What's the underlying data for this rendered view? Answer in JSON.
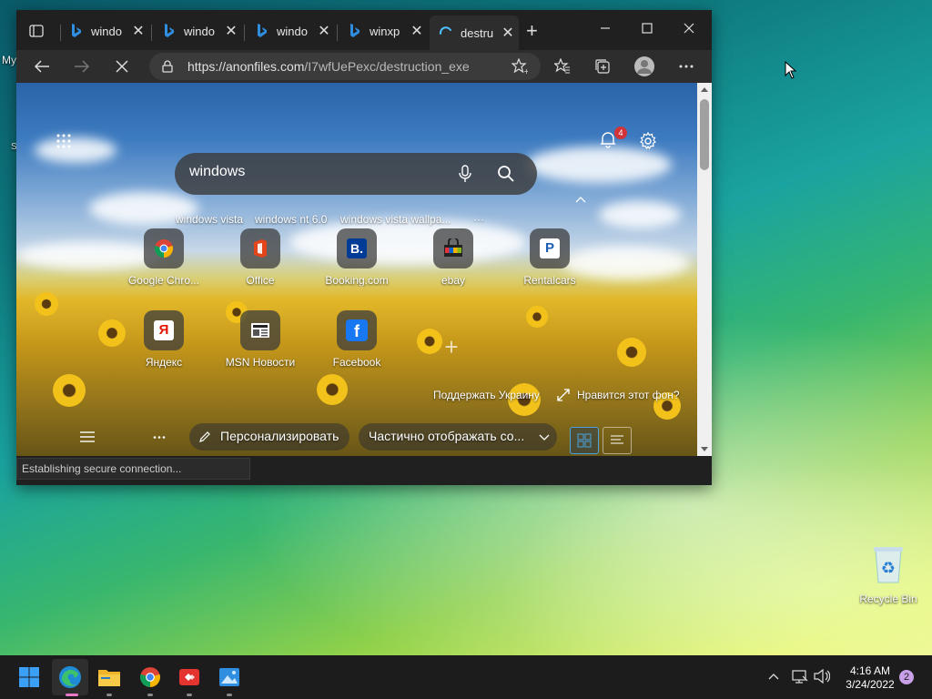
{
  "desktop": {
    "left_fragment_1": "My",
    "left_fragment_2": "S",
    "recycle_bin_label": "Recycle Bin"
  },
  "browser": {
    "tabs": [
      {
        "title": "windo",
        "icon": "bing-icon"
      },
      {
        "title": "windo",
        "icon": "bing-icon"
      },
      {
        "title": "windo",
        "icon": "bing-icon"
      },
      {
        "title": "winxp",
        "icon": "bing-icon"
      },
      {
        "title": "destru",
        "icon": "loading-icon",
        "active": true
      }
    ],
    "address": {
      "host": "https://anonfiles.com",
      "path": "/I7wfUePexc/destruction_exe"
    },
    "status": "Establishing secure connection..."
  },
  "newtab": {
    "notification_count": "4",
    "search_query": "windows",
    "suggestions": [
      "windows vista",
      "windows nt 6.0",
      "windows vista wallpa...",
      "···"
    ],
    "tiles": [
      {
        "label": "Google Chro...",
        "icon": "chrome-icon"
      },
      {
        "label": "Office",
        "icon": "office-icon"
      },
      {
        "label": "Booking.com",
        "icon": "booking-icon"
      },
      {
        "label": "ebay",
        "icon": "ebay-icon"
      },
      {
        "label": "Rentalcars",
        "icon": "rentalcars-icon"
      },
      {
        "label": "Яндекс",
        "icon": "yandex-icon"
      },
      {
        "label": "MSN Новости",
        "icon": "msn-news-icon"
      },
      {
        "label": "Facebook",
        "icon": "facebook-icon"
      }
    ],
    "support_ukraine": "Поддержать Украину",
    "like_background": "Нравится этот фон?",
    "personalize": "Персонализировать",
    "content_visibility": "Частично отображать со..."
  },
  "taskbar": {
    "time": "4:16 AM",
    "date": "3/24/2022",
    "notification_badge": "2"
  },
  "colors": {
    "accent_edge": "#2f8ee0",
    "badge_red": "#d13438"
  }
}
